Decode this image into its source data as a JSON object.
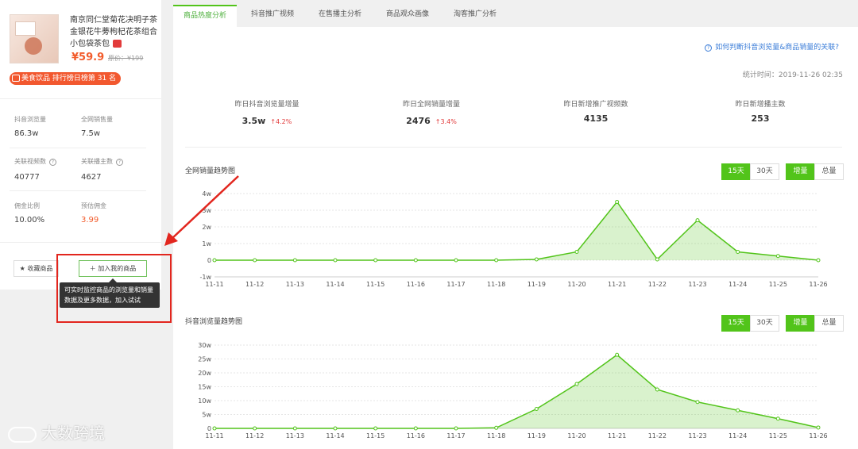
{
  "product": {
    "title": "南京同仁堂菊花决明子茶金银花牛蒡枸杞花茶组合小包袋茶包",
    "price": "¥59.9",
    "original_price": "原价：¥199",
    "rank_badge": "美食饮品 排行榜日榜第 31 名"
  },
  "sidebar_stats": [
    {
      "label": "抖音浏览量",
      "value": "86.3w"
    },
    {
      "label": "全网销售量",
      "value": "7.5w"
    },
    {
      "label": "关联视频数",
      "value": "40777",
      "help": true
    },
    {
      "label": "关联播主数",
      "value": "4627",
      "help": true
    },
    {
      "label": "佣金比例",
      "value": "10.00%"
    },
    {
      "label": "预估佣金",
      "value": "3.99",
      "color": "#f25c2c"
    }
  ],
  "actions": {
    "favorite_label": "收藏商品",
    "add_label": "加入我的商品",
    "tooltip": "可实时监控商品的浏览量和销量数据及更多数据，加入试试"
  },
  "watermark": "大数跨境",
  "tabs": [
    {
      "label": "商品热度分析",
      "active": true
    },
    {
      "label": "抖音推广视频",
      "active": false
    },
    {
      "label": "在售播主分析",
      "active": false
    },
    {
      "label": "商品观众画像",
      "active": false
    },
    {
      "label": "淘客推广分析",
      "active": false
    }
  ],
  "help_link": "如何判断抖音浏览量&商品销量的关联?",
  "stat_time": "统计时间：2019-11-26 02:35",
  "kpis": [
    {
      "label": "昨日抖音浏览量增量",
      "value": "3.5w",
      "delta": "↑4.2%"
    },
    {
      "label": "昨日全网销量增量",
      "value": "2476",
      "delta": "↑3.4%"
    },
    {
      "label": "昨日新增推广视频数",
      "value": "4135",
      "delta": ""
    },
    {
      "label": "昨日新增播主数",
      "value": "253",
      "delta": ""
    }
  ],
  "range_buttons": {
    "d15": "15天",
    "d30": "30天",
    "incr": "增量",
    "total": "总量"
  },
  "accent_color": "#52c41a",
  "chart_data": [
    {
      "type": "area",
      "title": "全网销量趋势图",
      "x": [
        "11-11",
        "11-12",
        "11-13",
        "11-14",
        "11-15",
        "11-16",
        "11-17",
        "11-18",
        "11-19",
        "11-20",
        "11-21",
        "11-22",
        "11-23",
        "11-24",
        "11-25",
        "11-26"
      ],
      "y_ticks": [
        "4w",
        "3w",
        "2w",
        "1w",
        "0",
        "-1w"
      ],
      "ylim": [
        -1,
        4
      ],
      "values": [
        0,
        0,
        0,
        0,
        0,
        0,
        0,
        0,
        0.05,
        0.5,
        3.5,
        0.05,
        2.4,
        0.5,
        0.25,
        0
      ],
      "color": "#52c41a",
      "grid": true
    },
    {
      "type": "area",
      "title": "抖音浏览量趋势图",
      "x": [
        "11-11",
        "11-12",
        "11-13",
        "11-14",
        "11-15",
        "11-16",
        "11-17",
        "11-18",
        "11-19",
        "11-20",
        "11-21",
        "11-22",
        "11-23",
        "11-24",
        "11-25",
        "11-26"
      ],
      "y_ticks": [
        "30w",
        "25w",
        "20w",
        "15w",
        "10w",
        "5w",
        "0"
      ],
      "ylim": [
        0,
        30
      ],
      "values": [
        0,
        0,
        0,
        0,
        0,
        0,
        0,
        0.2,
        7,
        16,
        26.5,
        14,
        9.5,
        6.5,
        3.5,
        0.3
      ],
      "color": "#52c41a",
      "grid": true
    }
  ]
}
